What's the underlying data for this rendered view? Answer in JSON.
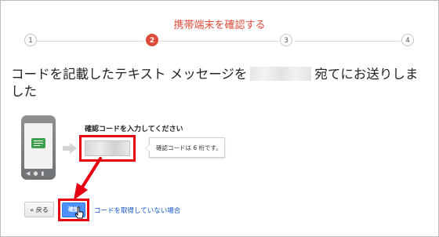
{
  "stepper": {
    "title": "携帯端末を確認する",
    "steps": [
      "1",
      "2",
      "3",
      "4"
    ],
    "active_step": "2",
    "active_color": "#dd4b39"
  },
  "message": {
    "prefix": "コードを記載したテキスト メッセージを",
    "suffix": "宛てにお送りしました"
  },
  "form": {
    "label": "確認コードを入力してください",
    "tooltip": "確認コードは 6 桁です。"
  },
  "actions": {
    "back_label": "« 戻る",
    "confirm_label": "確認",
    "no_code_link": "コードを取得していない場合"
  },
  "colors": {
    "highlight": "#e60012",
    "primary_button": "#4d90fe",
    "link": "#1155cc"
  }
}
